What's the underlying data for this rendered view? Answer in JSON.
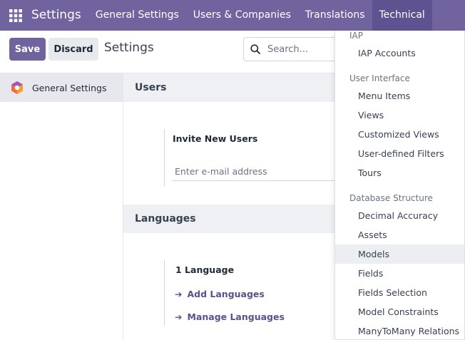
{
  "navbar": {
    "brand": "Settings",
    "items": [
      {
        "label": "General Settings"
      },
      {
        "label": "Users & Companies"
      },
      {
        "label": "Translations"
      },
      {
        "label": "Technical"
      }
    ]
  },
  "control": {
    "save_label": "Save",
    "discard_label": "Discard",
    "title": "Settings",
    "search_placeholder": "Search..."
  },
  "sidebar": {
    "items": [
      {
        "label": "General Settings",
        "icon": "odoo-settings-icon"
      }
    ]
  },
  "main": {
    "users": {
      "title": "Users",
      "invite_label": "Invite New Users",
      "email_placeholder": "Enter e-mail address"
    },
    "languages": {
      "title": "Languages",
      "count_label": "1 Language",
      "add_link": "Add Languages",
      "manage_link": "Manage Languages"
    }
  },
  "dropdown": {
    "groups": [
      {
        "header": "IAP",
        "items": [
          "IAP Accounts"
        ]
      },
      {
        "header": "User Interface",
        "items": [
          "Menu Items",
          "Views",
          "Customized Views",
          "User-defined Filters",
          "Tours"
        ]
      },
      {
        "header": "Database Structure",
        "items": [
          "Decimal Accuracy",
          "Assets",
          "Models",
          "Fields",
          "Fields Selection",
          "Model Constraints",
          "ManyToMany Relations"
        ]
      }
    ],
    "hovered_item": "Models"
  },
  "colors": {
    "brand": "#71639e",
    "active_nav": "#5f5290",
    "link": "#5d4f8d"
  }
}
